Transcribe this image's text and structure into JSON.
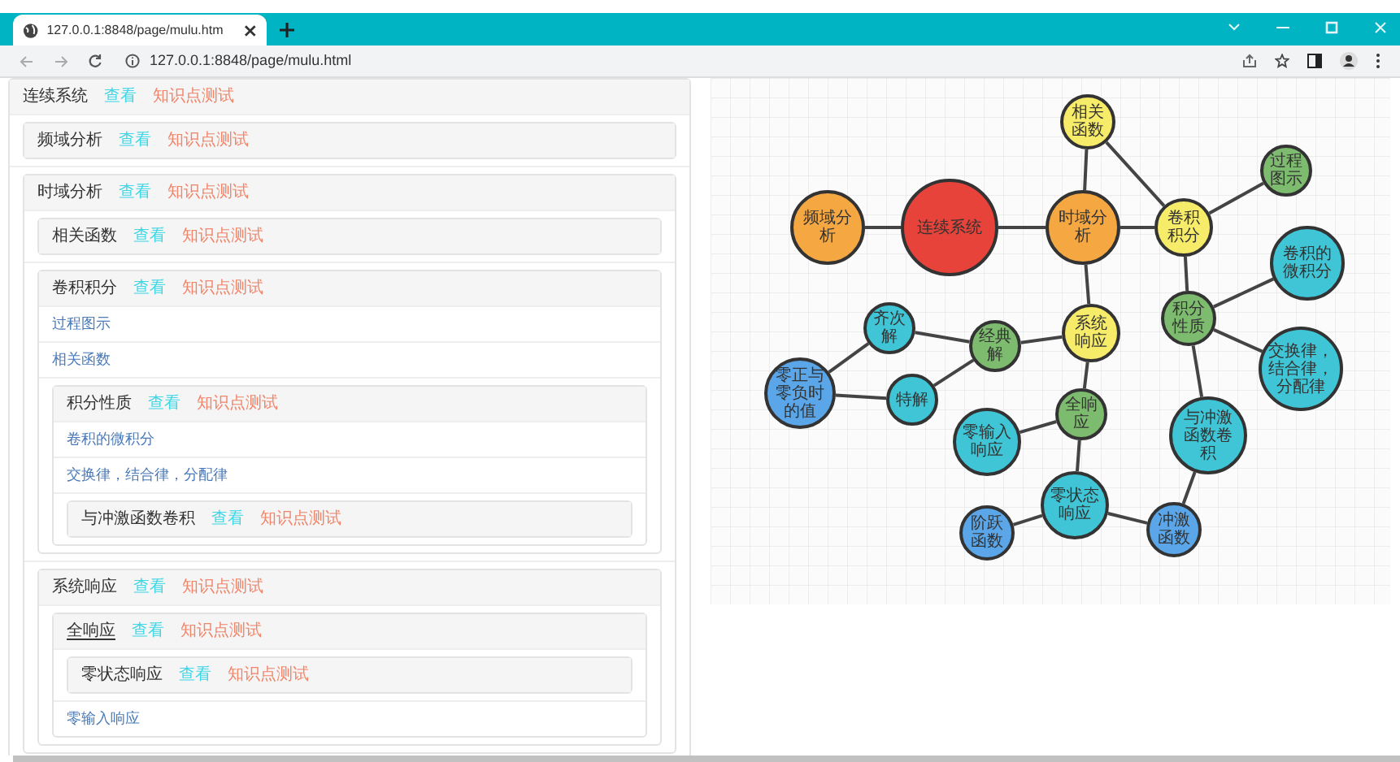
{
  "browser": {
    "tab_title": "127.0.0.1:8848/page/mulu.htm",
    "url": "127.0.0.1:8848/page/mulu.html"
  },
  "outline": {
    "kind": "panel",
    "title": "连续系统",
    "view": "查看",
    "test": "知识点测试",
    "underlined": false,
    "children": [
      {
        "kind": "panel",
        "title": "频域分析",
        "view": "查看",
        "test": "知识点测试",
        "underlined": false
      },
      {
        "kind": "panel",
        "title": "时域分析",
        "view": "查看",
        "test": "知识点测试",
        "underlined": false,
        "children": [
          {
            "kind": "panel",
            "title": "相关函数",
            "view": "查看",
            "test": "知识点测试",
            "underlined": false
          },
          {
            "kind": "panel",
            "title": "卷积积分",
            "view": "查看",
            "test": "知识点测试",
            "underlined": false,
            "children": [
              {
                "kind": "link",
                "title": "过程图示"
              },
              {
                "kind": "link",
                "title": "相关函数"
              },
              {
                "kind": "panel",
                "title": "积分性质",
                "view": "查看",
                "test": "知识点测试",
                "underlined": false,
                "children": [
                  {
                    "kind": "link",
                    "title": "卷积的微积分"
                  },
                  {
                    "kind": "link",
                    "title": "交换律，结合律，分配律"
                  },
                  {
                    "kind": "panel",
                    "title": "与冲激函数卷积",
                    "view": "查看",
                    "test": "知识点测试",
                    "underlined": false
                  }
                ]
              }
            ]
          },
          {
            "kind": "panel",
            "title": "系统响应",
            "view": "查看",
            "test": "知识点测试",
            "underlined": false,
            "children": [
              {
                "kind": "panel",
                "title": "全响应",
                "view": "查看",
                "test": "知识点测试",
                "underlined": true,
                "children": [
                  {
                    "kind": "panel",
                    "title": "零状态响应",
                    "view": "查看",
                    "test": "知识点测试",
                    "underlined": false
                  },
                  {
                    "kind": "link",
                    "title": "零输入响应"
                  }
                ]
              }
            ]
          }
        ]
      }
    ]
  },
  "diagram": {
    "nodes": [
      {
        "label": "相关函数",
        "color": "#f7ec6a"
      },
      {
        "label": "过程图示",
        "color": "#7dbb6e"
      },
      {
        "label": "频域分析",
        "color": "#f5a742"
      },
      {
        "label": "连续系统",
        "color": "#e8433a"
      },
      {
        "label": "时域分析",
        "color": "#f5a742"
      },
      {
        "label": "卷积积分",
        "color": "#f7ec6a"
      },
      {
        "label": "卷积的微积分",
        "color": "#3fc5d5"
      },
      {
        "label": "零正与零负时的值",
        "color": "#5aa6e8"
      },
      {
        "label": "齐次解",
        "color": "#3fc5d5"
      },
      {
        "label": "特解",
        "color": "#3fc5d5"
      },
      {
        "label": "经典解",
        "color": "#7dbb6e"
      },
      {
        "label": "系统响应",
        "color": "#f7ec6a"
      },
      {
        "label": "积分性质",
        "color": "#7dbb6e"
      },
      {
        "label": "交换律，结合律，分配律",
        "color": "#3fc5d5"
      },
      {
        "label": "零输入响应",
        "color": "#3fc5d5"
      },
      {
        "label": "全响应",
        "color": "#7dbb6e"
      },
      {
        "label": "与冲激函数卷积",
        "color": "#3fc5d5"
      },
      {
        "label": "阶跃函数",
        "color": "#5aa6e8"
      },
      {
        "label": "零状态响应",
        "color": "#3fc5d5"
      },
      {
        "label": "冲激函数",
        "color": "#5aa6e8"
      }
    ]
  }
}
